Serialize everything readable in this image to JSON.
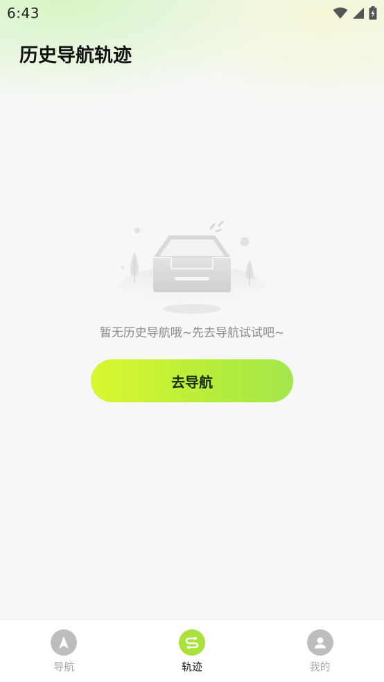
{
  "status_bar": {
    "time": "6:43",
    "icons": [
      "wifi-icon",
      "cell-signal-icon",
      "battery-charging-icon"
    ]
  },
  "header": {
    "title": "历史导航轨迹"
  },
  "empty_state": {
    "illustration": "empty-inbox-tray-illustration",
    "message": "暂无历史导航哦~先去导航试试吧~",
    "button_label": "去导航"
  },
  "tab_bar": {
    "items": [
      {
        "label": "导航",
        "icon": "navigation-arrow-icon",
        "active": false
      },
      {
        "label": "轨迹",
        "icon": "track-route-icon",
        "active": true
      },
      {
        "label": "我的",
        "icon": "user-profile-icon",
        "active": false
      }
    ]
  },
  "colors": {
    "accent_start": "#d9f72f",
    "accent_end": "#a2e64c",
    "active_tab_icon": "#a8e23a",
    "inactive_tab_icon": "#bdbdbd",
    "background": "#f7f7f7"
  }
}
